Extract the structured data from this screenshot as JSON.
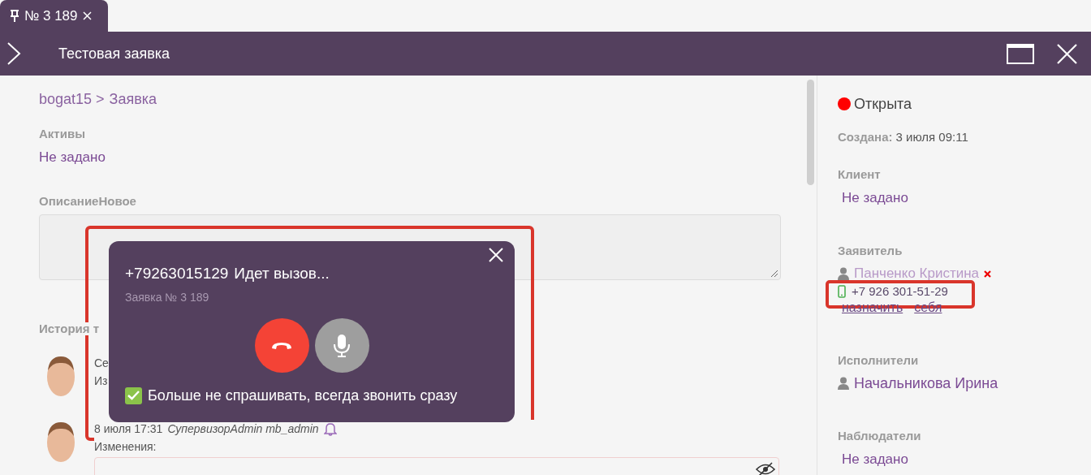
{
  "tab": {
    "label": "№ 3 189"
  },
  "header": {
    "title": "Тестовая заявка"
  },
  "main": {
    "breadcrumb": [
      "bogat15 >",
      "Заявка"
    ],
    "fields": [
      {
        "label": "Активы",
        "value": "Не задано"
      }
    ],
    "description": {
      "label": "ОписаниеНовое"
    },
    "history": {
      "title": "История т",
      "entries": [
        {
          "lines": [
            "Се",
            "Из"
          ]
        },
        {
          "date": "8 июля 17:31",
          "author": "СупервизорAdmin mb_admin",
          "lines": [
            "Изменения:"
          ]
        }
      ]
    }
  },
  "sidebar": {
    "status": {
      "label": "Открыта",
      "color": "#ff0000"
    },
    "created": {
      "label": "Создана:",
      "value": "3 июля 09:11"
    },
    "client": {
      "label": "Клиент",
      "value": "Не задано"
    },
    "requester": {
      "label": "Заявитель",
      "name": "Панченко Кристина",
      "phone": "+7 926 301-51-29",
      "actions": [
        "назначить",
        "себя"
      ]
    },
    "assignees": {
      "label": "Исполнители",
      "items": [
        "Начальникова Ирина"
      ]
    },
    "watchers": {
      "label": "Наблюдатели",
      "value": "Не задано"
    }
  },
  "call_popup": {
    "number": "+79263015129",
    "status": "Идет вызов...",
    "subtitle": "Заявка № 3 189",
    "remember": {
      "label": "Больше не спрашивать, всегда звонить сразу",
      "checked": true
    }
  }
}
